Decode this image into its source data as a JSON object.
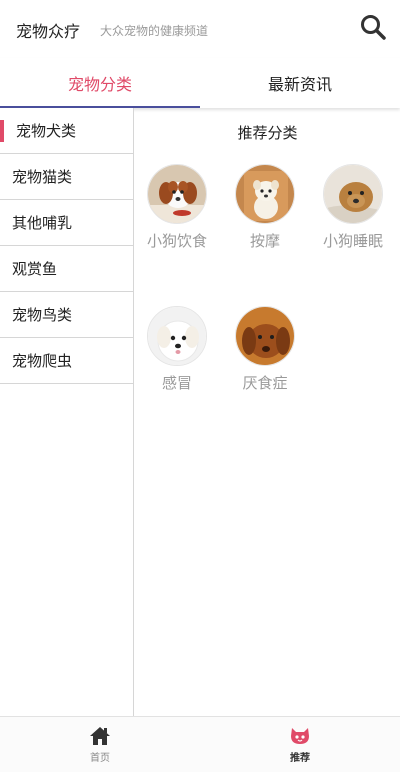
{
  "header": {
    "title": "宠物众疗",
    "subtitle": "大众宠物的健康频道",
    "search_icon": "search-icon"
  },
  "tabs": [
    {
      "label": "宠物分类",
      "active": true
    },
    {
      "label": "最新资讯",
      "active": false
    }
  ],
  "sidebar": {
    "items": [
      {
        "label": "宠物犬类",
        "active": true
      },
      {
        "label": "宠物猫类"
      },
      {
        "label": "其他哺乳"
      },
      {
        "label": "观赏鱼"
      },
      {
        "label": "宠物鸟类"
      },
      {
        "label": "宠物爬虫"
      }
    ]
  },
  "main": {
    "section_title": "推荐分类",
    "categories": [
      {
        "label": "小狗饮食",
        "image": "puppy-eating-photo"
      },
      {
        "label": "按摩",
        "image": "white-puppy-photo"
      },
      {
        "label": "小狗睡眠",
        "image": "sleeping-puppy-photo"
      },
      {
        "label": "感冒",
        "image": "white-fluffy-puppy-photo"
      },
      {
        "label": "厌食症",
        "image": "brown-dog-photo"
      }
    ]
  },
  "bottom_nav": [
    {
      "label": "首页",
      "icon": "home-icon"
    },
    {
      "label": "推荐",
      "icon": "cat-face-icon"
    }
  ],
  "colors": {
    "accent": "#e04a68",
    "tab_underline": "#4a4f9c",
    "muted_text": "#9a9a9a"
  }
}
